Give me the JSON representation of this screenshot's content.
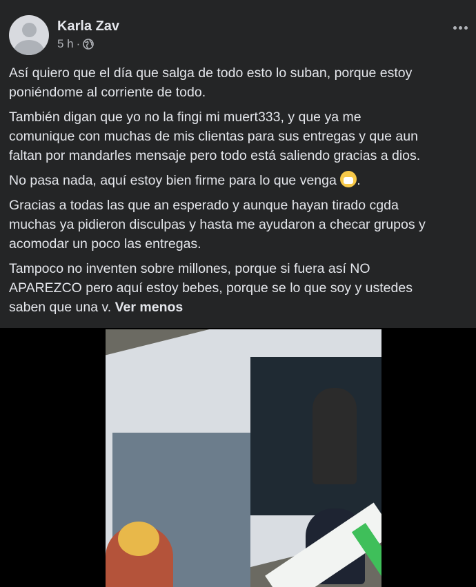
{
  "post": {
    "author": "Karla Zav",
    "time": "5 h",
    "separator": "·",
    "privacy_icon": "globe-icon",
    "more_icon": "more-options-icon",
    "paragraphs": [
      [
        "Así quiero que el día que salga de todo esto lo suban, porque estoy",
        "poniéndome al corriente de todo."
      ],
      [
        "También digan que yo no la fingi mi muert333, y que ya me",
        "comunique con muchas de mis clientas para sus entregas y que aun",
        "faltan por mandarles mensaje pero todo está saliendo gracias a dios."
      ],
      [
        "No pasa nada, aquí estoy bien firme para lo que venga"
      ],
      [
        "Gracias a todas las que an esperado y aunque hayan tirado cgda",
        "muchas ya pidieron disculpas y hasta me ayudaron a checar grupos y",
        "acomodar un poco las entregas."
      ],
      [
        "Tampoco no inventen sobre millones, porque si fuera así NO",
        "APAREZCO pero aquí estoy bebes, porque se lo que soy y ustedes",
        "saben que una v."
      ]
    ],
    "emoji": "fearful-face-emoji",
    "see_less": "Ver menos"
  },
  "colors": {
    "card_bg": "#242526",
    "text": "#e4e6eb",
    "secondary_text": "#b0b3b8",
    "page_bg": "#000000"
  }
}
